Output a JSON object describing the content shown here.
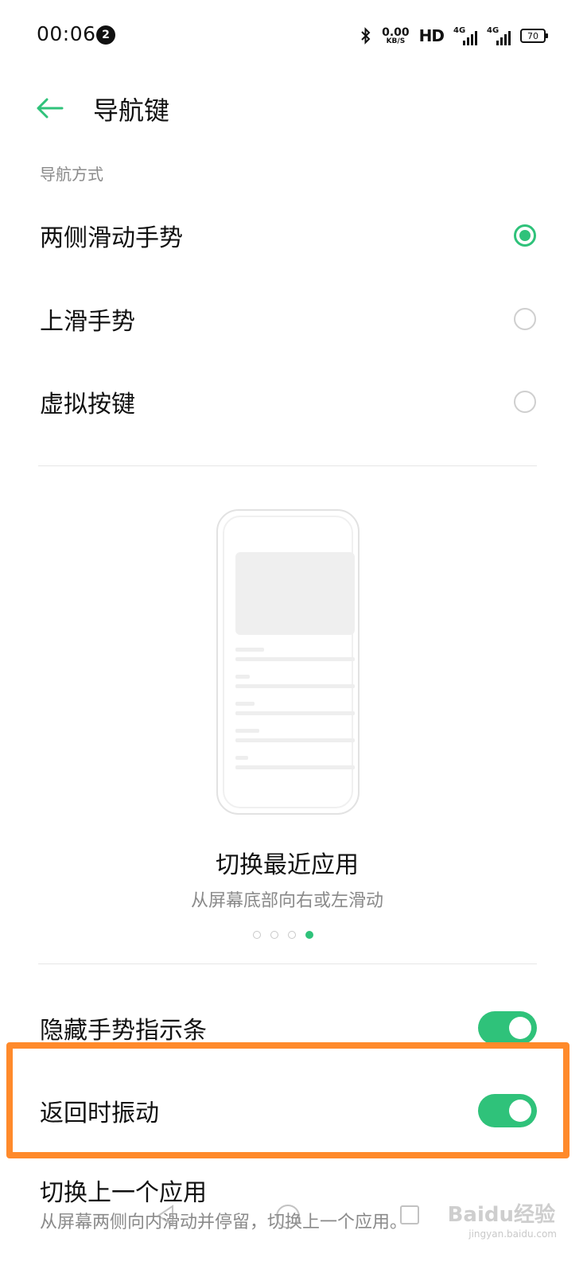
{
  "status_bar": {
    "time": "00:06",
    "notification_count": "2",
    "net_speed_value": "0.00",
    "net_speed_unit": "KB/S",
    "hd_label": "HD",
    "signal1_label": "4G",
    "signal2_label": "4G",
    "battery": "70"
  },
  "header": {
    "title": "导航键"
  },
  "navigation_mode": {
    "section_label": "导航方式",
    "options": [
      {
        "label": "两侧滑动手势",
        "selected": true
      },
      {
        "label": "上滑手势",
        "selected": false
      },
      {
        "label": "虚拟按键",
        "selected": false
      }
    ]
  },
  "illustration": {
    "title": "切换最近应用",
    "subtitle": "从屏幕底部向右或左滑动",
    "page_count": 4,
    "active_page": 4
  },
  "settings": {
    "hide_gesture_bar": {
      "label": "隐藏手势指示条",
      "on": true
    },
    "vibrate_on_back": {
      "label": "返回时振动",
      "on": true
    },
    "switch_prev_app": {
      "title": "切换上一个应用",
      "subtitle": "从屏幕两侧向内滑动并停留，切换上一个应用。"
    }
  },
  "watermark": {
    "text": "Baidu经验",
    "url": "jingyan.baidu.com"
  },
  "colors": {
    "accent": "#2fc27a",
    "highlight": "#ff8a2b"
  }
}
